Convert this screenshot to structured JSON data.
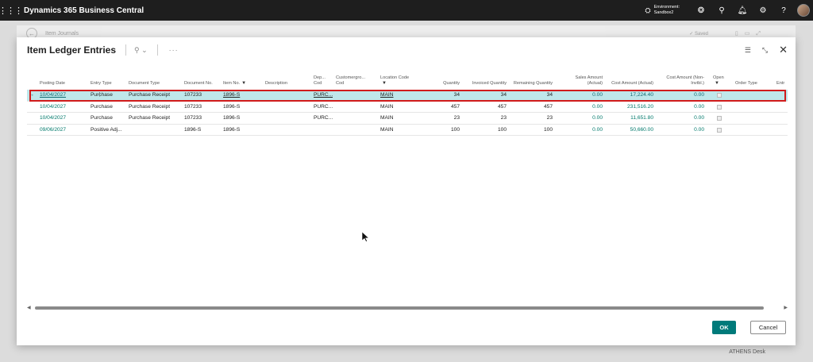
{
  "topbar": {
    "title": "Dynamics 365 Business Central",
    "environment_line1": "Environment:",
    "environment_line2": "Sandbox2"
  },
  "background_page": {
    "title": "Item Journals",
    "saved_label": "✓ Saved"
  },
  "dialog": {
    "title": "Item Ledger Entries",
    "columns": [
      {
        "label": "Posting Date"
      },
      {
        "label": "Entry Type"
      },
      {
        "label": "Document Type"
      },
      {
        "label": "Document No."
      },
      {
        "label": "Item No."
      },
      {
        "label": "Description"
      },
      {
        "label": "Dep... Cod"
      },
      {
        "label": "Customergro... Cod"
      },
      {
        "label": "Location Code"
      },
      {
        "label": "Quantity"
      },
      {
        "label": "Invoiced Quantity"
      },
      {
        "label": "Remaining Quantity"
      },
      {
        "label": "Sales Amount (Actual)"
      },
      {
        "label": "Cost Amount (Actual)"
      },
      {
        "label": "Cost Amount (Non-Invtbl.)"
      },
      {
        "label": "Open"
      },
      {
        "label": "Order Type"
      },
      {
        "label": "Entr"
      }
    ],
    "rows": [
      {
        "posting_date": "10/04/2027",
        "entry_type": "Purchase",
        "document_type": "Purchase Receipt",
        "document_no": "107233",
        "item_no": "1896-S",
        "description": "",
        "dept_code": "PURC...",
        "customer_group_code": "",
        "location_code": "MAIN",
        "quantity": "34",
        "invoiced_quantity": "34",
        "remaining_quantity": "34",
        "sales_amount": "0.00",
        "cost_amount": "17,224.40",
        "cost_amount_non_invtbl": "0.00",
        "selected": true
      },
      {
        "posting_date": "10/04/2027",
        "entry_type": "Purchase",
        "document_type": "Purchase Receipt",
        "document_no": "107233",
        "item_no": "1896-S",
        "description": "",
        "dept_code": "PURC...",
        "customer_group_code": "",
        "location_code": "MAIN",
        "quantity": "457",
        "invoiced_quantity": "457",
        "remaining_quantity": "457",
        "sales_amount": "0.00",
        "cost_amount": "231,516.20",
        "cost_amount_non_invtbl": "0.00",
        "selected": false
      },
      {
        "posting_date": "10/04/2027",
        "entry_type": "Purchase",
        "document_type": "Purchase Receipt",
        "document_no": "107233",
        "item_no": "1896-S",
        "description": "",
        "dept_code": "PURC...",
        "customer_group_code": "",
        "location_code": "MAIN",
        "quantity": "23",
        "invoiced_quantity": "23",
        "remaining_quantity": "23",
        "sales_amount": "0.00",
        "cost_amount": "11,651.80",
        "cost_amount_non_invtbl": "0.00",
        "selected": false
      },
      {
        "posting_date": "09/06/2027",
        "entry_type": "Positive Adj...",
        "document_type": "",
        "document_no": "1896-S",
        "item_no": "1896-S",
        "description": "",
        "dept_code": "",
        "customer_group_code": "",
        "location_code": "MAIN",
        "quantity": "100",
        "invoiced_quantity": "100",
        "remaining_quantity": "100",
        "sales_amount": "0.00",
        "cost_amount": "50,660.00",
        "cost_amount_non_invtbl": "0.00",
        "selected": false
      }
    ],
    "ok_label": "OK",
    "cancel_label": "Cancel"
  },
  "footer": {
    "text": "ATHENS Desk"
  },
  "colors": {
    "accent": "#007a7a",
    "selected_row": "#bfe7ea",
    "highlight_frame": "#d11b1b",
    "link": "#00796b"
  }
}
